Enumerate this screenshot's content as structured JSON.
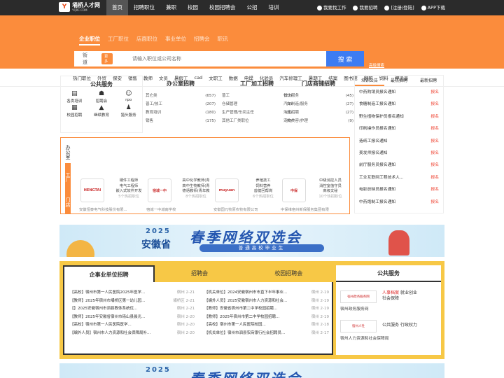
{
  "topbar": {
    "logo_text": "埇桥人才网",
    "logo_sub": "YQRC.COM",
    "nav": [
      "首页",
      "招聘职位",
      "兼职",
      "校园",
      "校园招聘会",
      "公招",
      "培训"
    ],
    "links": [
      "我要找工作",
      "我要招聘",
      "[注册/登陆]",
      "APP下载"
    ]
  },
  "search": {
    "tabs": [
      "企业职位",
      "工厂职位",
      "店面职位",
      "事业单位",
      "招聘会",
      "职讯"
    ],
    "city": "街道",
    "city_badge": "更多",
    "placeholder": "请输入职位或公司名称",
    "button": "搜 索",
    "advanced": "高级搜索"
  },
  "hot": [
    "热门职位",
    "外贸",
    "保安",
    "销售",
    "教师",
    "文员",
    "暑假工",
    "cad",
    "文职工",
    "数据",
    "电焊",
    "化验员",
    "汽车修理工",
    "暑期工",
    "结案",
    "图书馆",
    "翻照",
    "饲料",
    "押运员"
  ],
  "public_service": {
    "title": "公共服务",
    "items": [
      {
        "label": "各类培训",
        "icon": "book-icon"
      },
      {
        "label": "招聘会",
        "icon": "group-icon"
      },
      {
        "label": "rpo",
        "icon": "user-icon"
      },
      {
        "label": "校园招聘",
        "icon": "calendar-icon"
      },
      {
        "label": "继续教育",
        "icon": "graduate-icon"
      },
      {
        "label": "猎头服务",
        "icon": "person-icon"
      }
    ]
  },
  "categories": [
    {
      "title": "办公室招聘",
      "rows": [
        [
          "其它类",
          "(657)"
        ],
        [
          "普工/技工",
          "(207)"
        ],
        [
          "教育培训",
          "(180)"
        ],
        [
          "销售",
          "(175)"
        ]
      ]
    },
    {
      "title": "工厂加工招聘",
      "rows": [
        [
          "普工",
          "(27)"
        ],
        [
          "仓储管理",
          "(9)"
        ],
        [
          "生产管理/车间主任",
          "(6)"
        ],
        [
          "其他工厂类职位",
          "(6)"
        ]
      ]
    },
    {
      "title": "门店商铺招聘",
      "rows": [
        [
          "餐饮服务",
          "(45)"
        ],
        [
          "汽车制造/服务",
          "(27)"
        ],
        [
          "淘宝招聘",
          "(27)"
        ],
        [
          "宠物美容/护理",
          "(9)"
        ]
      ]
    }
  ],
  "sidebar": {
    "tabs": [
      "培训公告",
      "最热招聘",
      "最新招聘"
    ],
    "items": [
      "中药购销员报名通知",
      "食糖制造工报名通知",
      "野生植物保护员报名通知",
      "印刷操作员报名通知",
      "造纸工报名通知",
      "美发师报名通知",
      "前厅服务员报名通知",
      "工业互联网工程技术人...",
      "电影放映员报名通知",
      "中药炮制工报名通知"
    ],
    "tag": "报名"
  },
  "jobs": {
    "vtabs": [
      "办公室",
      "工厂",
      "门店"
    ],
    "companies": [
      {
        "logo": "HENGTAI",
        "jobs": [
          "硬件工程师",
          "电气工程师",
          "嵌入式软件开发"
        ],
        "more": "5个热招职位",
        "name": "安徽恒泰电气科技股份有限..."
      },
      {
        "logo": "宿城一中",
        "jobs": [
          "高中化学教师(青",
          "高中生物教师(青",
          "德语教师(青年教"
        ],
        "more": "8个热招职位",
        "name": "宿城一中城南学校"
      },
      {
        "logo": "muyuan",
        "jobs": [
          "养殖技工",
          "饲料营养",
          "兽健回帮岗"
        ],
        "more": "6个热招职位",
        "name": "安徽国元牧原农牧有限公司"
      },
      {
        "logo": "中保",
        "jobs": [
          "中級消控人员",
          "消控室值守员",
          "高级文秘"
        ],
        "more": "10个热招职位",
        "name": "中保维宿州新保服务集团有限"
      }
    ]
  },
  "banner": {
    "year": "2025",
    "province": "安徽省",
    "title": "春季网络双选会",
    "sub": "普通高校毕业生"
  },
  "listing": {
    "tabs": [
      "企事业单位招聘",
      "招聘会",
      "校园招聘会"
    ],
    "left": [
      [
        "【高校】宿州市第一人民医院2025年医学...",
        "宿州 2-21"
      ],
      [
        "【教师】2025年宿州市埇桥区第一幼儿园...",
        "埇桥区 2-21"
      ],
      [
        "【】2025安徽宿州市泗县教体系统优...",
        "宿州 2-21"
      ],
      [
        "【教师】2025年安徽省宿州市砀山县晨光...",
        "宿州 2-20"
      ],
      [
        "【高校】宿州市第一人民医院医学...",
        "宿州 2-20"
      ],
      [
        "【编外人员】宿州市人力资源和社会保障局补...",
        "宿州 2-20"
      ]
    ],
    "right": [
      [
        "【机关单位】2024安徽宿州市市直下半年事业...",
        "宿州 2-19"
      ],
      [
        "【编外人员】2025安徽宿州市人力资源和社会...",
        "宿州 2-19"
      ],
      [
        "【教师】安徽省宿州市第二中学校园招聘...",
        "宿州 2-19"
      ],
      [
        "【教师】2025年宿州市第二中学校园招聘...",
        "宿州 2-19"
      ],
      [
        "【高校】宿州市第一人民医院校园...",
        "宿州 2-18"
      ],
      [
        "【机关单位】宿州市泗县农商银行社会招聘员...",
        "宿州 2-17"
      ]
    ]
  },
  "public_service2": {
    "title": "公共服务",
    "blocks": [
      {
        "badge": "宿州政务服务网",
        "lines": [
          "人事档案",
          "就业创业",
          "社会保障"
        ],
        "name": "宿州政务服务网"
      },
      {
        "badge": "宿州人社",
        "lines": [
          "公共服务",
          "行政权力"
        ],
        "name": "宿州人力资源和社会保障局"
      }
    ]
  }
}
